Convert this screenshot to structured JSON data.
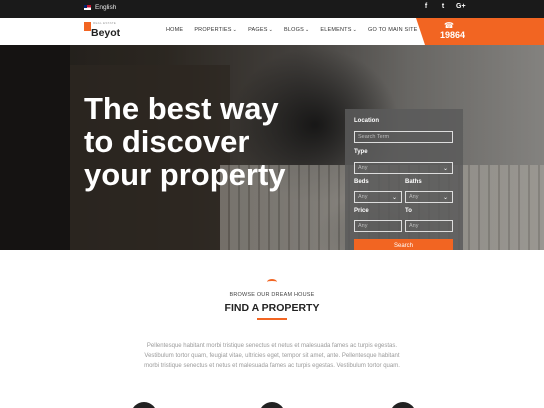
{
  "topbar": {
    "language": "English",
    "social": [
      "f",
      "t",
      "G+"
    ],
    "social_icons": [
      "facebook-icon",
      "twitter-icon",
      "google-plus-icon"
    ]
  },
  "header": {
    "logo_tagline": "REAL ESTATE",
    "logo_text": "Beyot",
    "nav": [
      {
        "label": "HOME",
        "dropdown": false
      },
      {
        "label": "PROPERTIES",
        "dropdown": true
      },
      {
        "label": "PAGES",
        "dropdown": true
      },
      {
        "label": "BLOGS",
        "dropdown": true
      },
      {
        "label": "ELEMENTS",
        "dropdown": true
      },
      {
        "label": "GO TO MAIN SITE",
        "dropdown": false
      }
    ],
    "phone": "19864"
  },
  "hero": {
    "title_lines": [
      "The best way",
      "to discover",
      "your property"
    ]
  },
  "search": {
    "location_label": "Location",
    "location_placeholder": "Search Term",
    "type_label": "Type",
    "type_value": "Any",
    "beds_label": "Beds",
    "beds_value": "Any",
    "baths_label": "Baths",
    "baths_value": "Any",
    "price_label": "Price",
    "price_from": "Any",
    "to_label": "To",
    "price_to": "Any",
    "button": "Search"
  },
  "find": {
    "eyebrow": "BROWSE OUR DREAM HOUSE",
    "title": "FIND A PROPERTY",
    "description_lines": [
      "Pellentesque habitant morbi tristique senectus et netus et malesuada fames ac turpis egestas.",
      "Vestibulum tortor quam, feugiat vitae, ultricies eget, tempor sit amet, ante. Pellentesque habitant",
      "morbi tristique senectus et netus et malesuada fames ac turpis egestas. Vestibulum tortor quam."
    ]
  },
  "colors": {
    "accent": "#f26522",
    "dark": "#1a1a1a"
  }
}
